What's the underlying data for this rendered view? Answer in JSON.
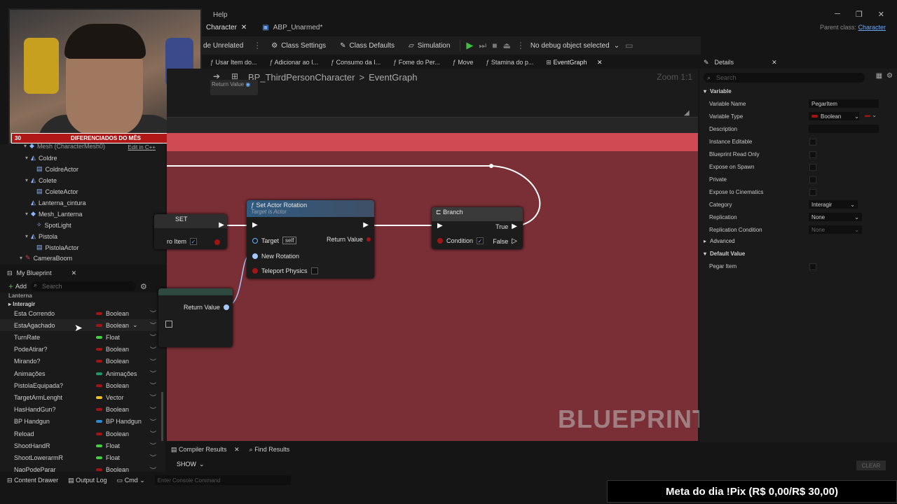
{
  "window": {
    "menu_help": "Help",
    "minimize": "─",
    "maximize": "❐",
    "close": "✕",
    "parent_class_label": "Parent class:",
    "parent_class_value": "Character"
  },
  "doc_tabs": [
    {
      "label": "Character",
      "close": "✕"
    },
    {
      "label": "ABP_Unarmed*"
    }
  ],
  "toolbar": {
    "hide_unrelated": "de Unrelated",
    "class_settings": "Class Settings",
    "class_defaults": "Class Defaults",
    "simulation": "Simulation",
    "debug_select": "No debug object selected"
  },
  "graph_tabs": [
    {
      "label": "Usar Item do..."
    },
    {
      "label": "Adicionar ao I..."
    },
    {
      "label": "Consumo da I..."
    },
    {
      "label": "Fome do Per..."
    },
    {
      "label": "Move"
    },
    {
      "label": "Stamina do p..."
    },
    {
      "label": "EventGraph",
      "close": "✕"
    }
  ],
  "webcam": {
    "goal_left": "30",
    "goal_label": "DIFERENCIADOS DO MÊS",
    "goal_right": "50"
  },
  "components": {
    "edit_cpp": "Edit in C++",
    "items": [
      {
        "label": "Mesh (CharacterMesh0)"
      },
      {
        "label": "Coldre"
      },
      {
        "label": "ColdreActor"
      },
      {
        "label": "Colete"
      },
      {
        "label": "ColeteActor"
      },
      {
        "label": "Lanterna_cintura"
      },
      {
        "label": "Mesh_Lanterna"
      },
      {
        "label": "SpotLight"
      },
      {
        "label": "Pistola"
      },
      {
        "label": "PistolaActor"
      },
      {
        "label": "CameraBoom"
      }
    ]
  },
  "my_blueprint": {
    "tab_label": "My Blueprint",
    "add_label": "Add",
    "search_placeholder": "Search",
    "cat_lanterna": "Lanterna",
    "cat_interagir": "Interagir",
    "variables": [
      {
        "name": "Esta Correndo",
        "type": "Boolean",
        "color": "#a31414"
      },
      {
        "name": "EstaAgachado",
        "type": "Boolean",
        "color": "#a31414"
      },
      {
        "name": "TurnRate",
        "type": "Float",
        "color": "#3fcf3f"
      },
      {
        "name": "PodeAtirar?",
        "type": "Boolean",
        "color": "#a31414"
      },
      {
        "name": "Mirando?",
        "type": "Boolean",
        "color": "#a31414"
      },
      {
        "name": "Animações",
        "type": "Animações",
        "color": "#1a9a6a"
      },
      {
        "name": "PistolaEquipada?",
        "type": "Boolean",
        "color": "#a31414"
      },
      {
        "name": "TargetArmLenght",
        "type": "Vector",
        "color": "#f0c020"
      },
      {
        "name": "HasHandGun?",
        "type": "Boolean",
        "color": "#a31414"
      },
      {
        "name": "BP Handgun",
        "type": "BP Handgun",
        "color": "#2a8ad8"
      },
      {
        "name": "Reload",
        "type": "Boolean",
        "color": "#a31414"
      },
      {
        "name": "ShootHandR",
        "type": "Float",
        "color": "#3fcf3f"
      },
      {
        "name": "ShootLowerarmR",
        "type": "Float",
        "color": "#3fcf3f"
      },
      {
        "name": "NaoPodeParar",
        "type": "Boolean",
        "color": "#a31414"
      }
    ]
  },
  "graph": {
    "breadcrumb_bp": "BP_ThirdPersonCharacter",
    "breadcrumb_sep": ">",
    "breadcrumb_graph": "EventGraph",
    "zoom": "Zoom 1:1",
    "return_value_mini": "Return Value",
    "watermark": "BLUEPRINT",
    "set_node": {
      "title": "SET",
      "pin": "ro Item"
    },
    "rotation_node": {
      "title": "Set Actor Rotation",
      "subtitle": "Target is Actor",
      "target": "Target",
      "self": "self",
      "return_value": "Return Value",
      "new_rotation": "New Rotation",
      "teleport": "Teleport Physics"
    },
    "branch_node": {
      "title": "Branch",
      "true": "True",
      "false": "False",
      "condition": "Condition"
    },
    "lower_node": {
      "return_value": "Return Value"
    }
  },
  "details": {
    "tab_label": "Details",
    "search_placeholder": "Search",
    "section_variable": "Variable",
    "variable_name_label": "Variable Name",
    "variable_name_value": "PegarItem",
    "variable_type_label": "Variable Type",
    "variable_type_value": "Boolean",
    "description_label": "Description",
    "instance_editable": "Instance Editable",
    "bp_read_only": "Blueprint Read Only",
    "expose_spawn": "Expose on Spawn",
    "private": "Private",
    "expose_cinematics": "Expose to Cinematics",
    "category_label": "Category",
    "category_value": "Interagir",
    "replication_label": "Replication",
    "replication_value": "None",
    "replication_condition_label": "Replication Condition",
    "replication_condition_value": "None",
    "section_advanced": "Advanced",
    "section_default": "Default Value",
    "pegar_item_label": "Pegar Item"
  },
  "bottom": {
    "compiler_results": "Compiler Results",
    "find_results": "Find Results",
    "show": "SHOW",
    "clear": "CLEAR",
    "content_drawer": "Content Drawer",
    "output_log": "Output Log",
    "cmd": "Cmd",
    "console_placeholder": "Enter Console Command"
  },
  "overlay": {
    "pix_goal": "Meta do dia !Pix (R$ 0,00/R$ 30,00)"
  },
  "colors": {
    "comment_body": "#7a2f36",
    "comment_header": "#d04a54",
    "bool_pin": "#a31414"
  }
}
